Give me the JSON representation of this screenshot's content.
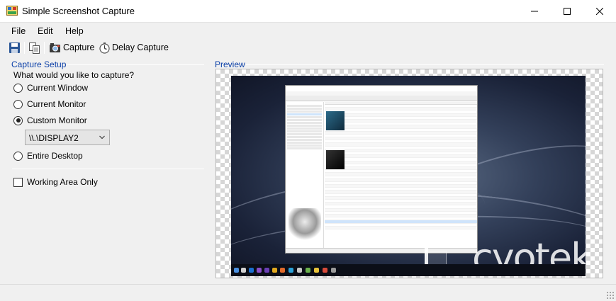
{
  "window": {
    "title": "Simple Screenshot Capture",
    "controls": {
      "minimize": "—",
      "maximize": "☐",
      "close": "✕"
    }
  },
  "menu": {
    "items": [
      {
        "label": "File"
      },
      {
        "label": "Edit"
      },
      {
        "label": "Help"
      }
    ]
  },
  "toolbar": {
    "save_icon": "save-icon",
    "copy_icon": "copy-icon",
    "capture_label": "Capture",
    "delay_capture_label": "Delay Capture"
  },
  "capture_setup": {
    "group_title": "Capture Setup",
    "prompt": "What would you like to capture?",
    "options": [
      {
        "label": "Current Window",
        "checked": false
      },
      {
        "label": "Current Monitor",
        "checked": false
      },
      {
        "label": "Custom Monitor",
        "checked": true
      },
      {
        "label": "Entire Desktop",
        "checked": false
      }
    ],
    "monitor_select": {
      "value": "\\\\.\\DISPLAY2"
    },
    "working_area_only": {
      "label": "Working Area Only",
      "checked": false
    }
  },
  "preview": {
    "group_title": "Preview",
    "watermark_text": "cyotek"
  },
  "colors": {
    "accent_text": "#0a3fa8",
    "chrome": "#f0f0f0",
    "desktop_bg": "#1a2238"
  }
}
